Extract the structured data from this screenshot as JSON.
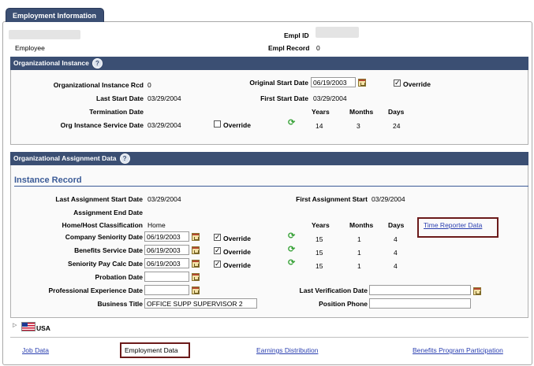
{
  "tab": {
    "label": "Employment Information"
  },
  "header": {
    "empl_id_label": "Empl ID",
    "employee_label": "Employee",
    "empl_record_label": "Empl Record",
    "empl_record_value": "0"
  },
  "org_instance": {
    "title": "Organizational Instance",
    "help": "?",
    "rcd_label": "Organizational Instance Rcd",
    "rcd_value": "0",
    "orig_start_label": "Original Start Date",
    "orig_start_value": "06/19/2003",
    "override_label": "Override",
    "last_start_label": "Last Start Date",
    "last_start_value": "03/29/2004",
    "first_start_label": "First Start Date",
    "first_start_value": "03/29/2004",
    "termination_label": "Termination Date",
    "years_hdr": "Years",
    "months_hdr": "Months",
    "days_hdr": "Days",
    "service_label": "Org Instance Service Date",
    "service_value": "03/29/2004",
    "service_override_label": "Override",
    "years": "14",
    "months": "3",
    "days": "24"
  },
  "org_assignment": {
    "title": "Organizational Assignment Data",
    "help": "?",
    "instance_title": "Instance Record",
    "last_assign_label": "Last Assignment Start Date",
    "last_assign_value": "03/29/2004",
    "first_assign_label": "First Assignment Start",
    "first_assign_value": "03/29/2004",
    "assign_end_label": "Assignment End Date",
    "home_host_label": "Home/Host Classification",
    "home_host_value": "Home",
    "years_hdr": "Years",
    "months_hdr": "Months",
    "days_hdr": "Days",
    "time_reporter_link": "Time Reporter Data",
    "rows": [
      {
        "label": "Company Seniority Date",
        "value": "06/19/2003",
        "override": "Override",
        "years": "15",
        "months": "1",
        "days": "4"
      },
      {
        "label": "Benefits Service Date",
        "value": "06/19/2003",
        "override": "Override",
        "years": "15",
        "months": "1",
        "days": "4"
      },
      {
        "label": "Seniority Pay Calc Date",
        "value": "06/19/2003",
        "override": "Override",
        "years": "15",
        "months": "1",
        "days": "4"
      }
    ],
    "probation_label": "Probation Date",
    "prof_exp_label": "Professional Experience Date",
    "last_verif_label": "Last Verification Date",
    "business_title_label": "Business Title",
    "business_title_value": "OFFICE SUPP SUPERVISOR 2",
    "position_phone_label": "Position Phone"
  },
  "country": {
    "label": "USA"
  },
  "footer": {
    "job_data": "Job Data",
    "employment_data": "Employment Data",
    "earnings": "Earnings Distribution",
    "benefits": "Benefits Program Participation"
  }
}
